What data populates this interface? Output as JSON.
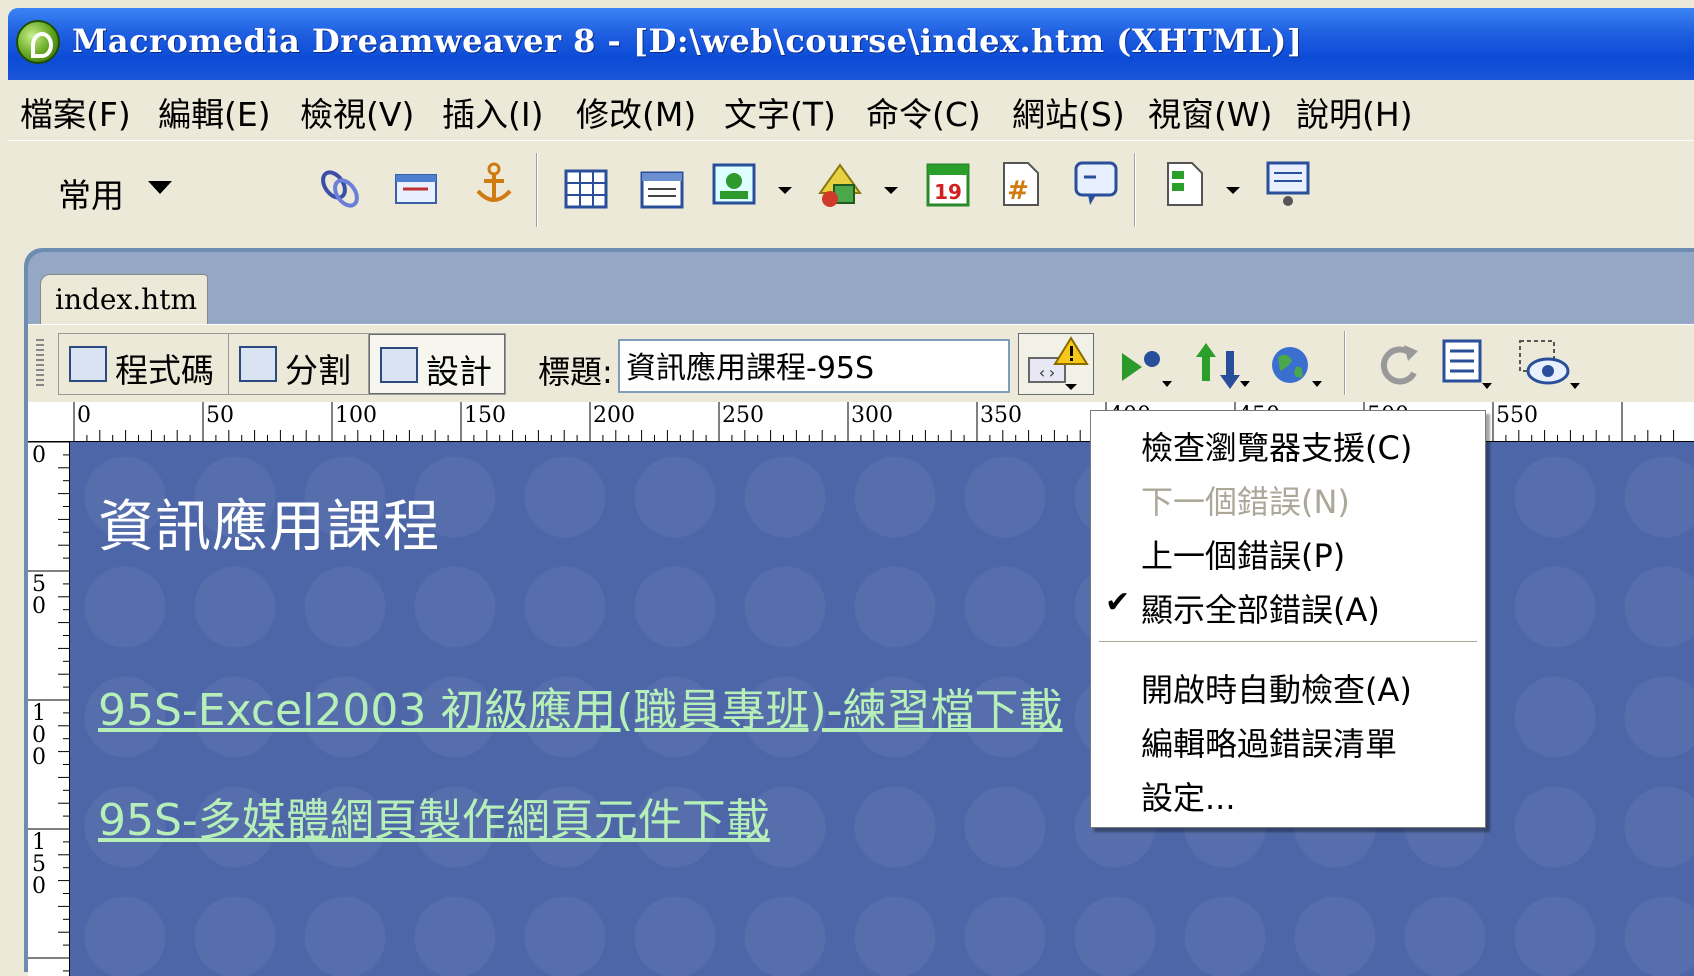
{
  "window": {
    "title": "Macromedia Dreamweaver 8 - [D:\\web\\course\\index.htm (XHTML)]",
    "app_icon": "dreamweaver-icon"
  },
  "menubar": {
    "items": [
      "檔案(F)",
      "編輯(E)",
      "檢視(V)",
      "插入(I)",
      "修改(M)",
      "文字(T)",
      "命令(C)",
      "網站(S)",
      "視窗(W)",
      "說明(H)"
    ]
  },
  "insert_toolbar": {
    "category": "常用",
    "icons": [
      "hyperlink-icon",
      "email-link-icon",
      "named-anchor-icon",
      "table-icon",
      "div-layer-icon",
      "image-icon",
      "media-icon",
      "date-icon",
      "server-side-include-icon",
      "comment-icon",
      "templates-icon",
      "tag-chooser-icon"
    ],
    "date_icon_text": "19"
  },
  "document": {
    "tab": "index.htm",
    "view_buttons": {
      "code": "程式碼",
      "split": "分割",
      "design": "設計"
    },
    "title_label": "標題:",
    "title_value": "資訊應用課程-95S",
    "ruler_h": [
      "0",
      "50",
      "100",
      "150",
      "200",
      "250",
      "300",
      "350",
      "400",
      "450",
      "500",
      "550"
    ],
    "ruler_v": [
      "0",
      "50",
      "100",
      "150"
    ],
    "content": {
      "heading": "資訊應用課程",
      "links": [
        "95S-Excel2003 初級應用(職員專班)-練習檔下載",
        "95S-多媒體網頁製作網頁元件下載"
      ]
    }
  },
  "browser_check_menu": {
    "items": [
      {
        "label": "檢查瀏覽器支援(C)",
        "enabled": true,
        "checked": false
      },
      {
        "label": "下一個錯誤(N)",
        "enabled": false,
        "checked": false
      },
      {
        "label": "上一個錯誤(P)",
        "enabled": true,
        "checked": false
      },
      {
        "label": "顯示全部錯誤(A)",
        "enabled": true,
        "checked": true
      }
    ],
    "items2": [
      {
        "label": "開啟時自動檢查(A)"
      },
      {
        "label": "編輯略過錯誤清單"
      },
      {
        "label": "設定..."
      }
    ]
  }
}
